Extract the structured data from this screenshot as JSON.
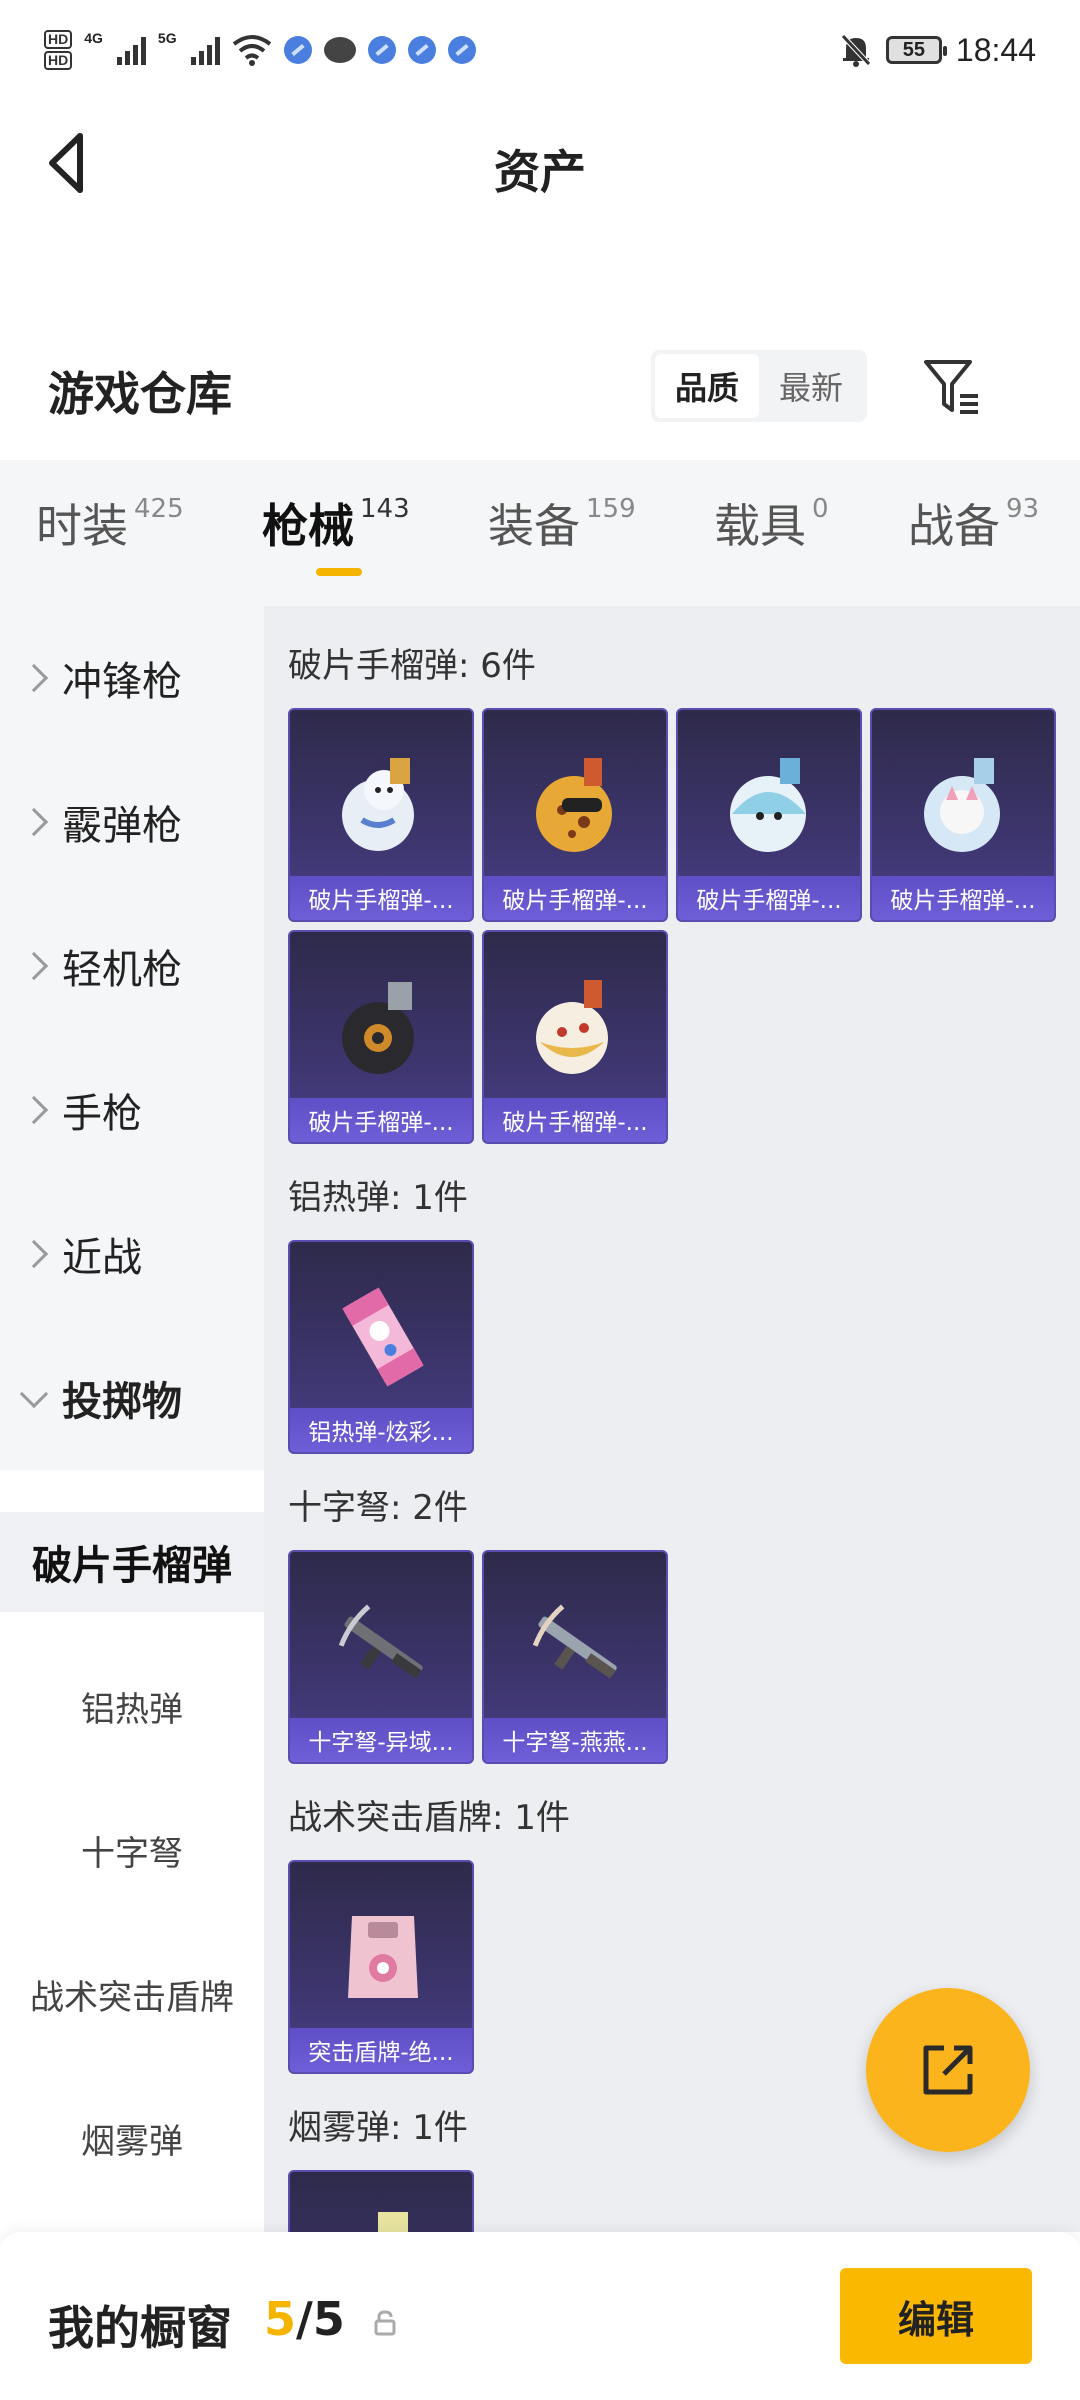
{
  "status_bar": {
    "time": "18:44",
    "battery": "55",
    "network_1": "4G",
    "network_2": "5G",
    "icons": [
      "hd-icon",
      "signal-icon",
      "signal-icon",
      "wifi-icon",
      "app-icon",
      "message-icon",
      "app-icon",
      "app-icon",
      "app-icon",
      "mute-bell-icon",
      "battery-icon"
    ]
  },
  "header": {
    "title": "资产"
  },
  "warehouse": {
    "title": "游戏仓库",
    "sort_options": [
      "品质",
      "最新"
    ],
    "sort_selected": "品质"
  },
  "tabs": [
    {
      "label": "时装",
      "count": "425"
    },
    {
      "label": "枪械",
      "count": "143",
      "active": true
    },
    {
      "label": "装备",
      "count": "159"
    },
    {
      "label": "载具",
      "count": "0"
    },
    {
      "label": "战备",
      "count": "93"
    }
  ],
  "sidebar": {
    "categories": [
      "冲锋枪",
      "霰弹枪",
      "轻机枪",
      "手枪",
      "近战",
      "投掷物"
    ],
    "open_category": "投掷物",
    "subitems": [
      "破片手榴弹",
      "铝热弹",
      "十字弩",
      "战术突击盾牌",
      "烟雾弹"
    ],
    "active_subitem": "破片手榴弹"
  },
  "groups": [
    {
      "title": "破片手榴弹: 6件",
      "items": [
        "破片手榴弹-...",
        "破片手榴弹-...",
        "破片手榴弹-...",
        "破片手榴弹-...",
        "破片手榴弹-...",
        "破片手榴弹-..."
      ]
    },
    {
      "title": "铝热弹: 1件",
      "items": [
        "铝热弹-炫彩..."
      ]
    },
    {
      "title": "十字弩: 2件",
      "items": [
        "十字弩-异域...",
        "十字弩-燕燕..."
      ]
    },
    {
      "title": "战术突击盾牌: 1件",
      "items": [
        "突击盾牌-绝..."
      ]
    },
    {
      "title": "烟雾弹: 1件",
      "items": [
        ""
      ]
    }
  ],
  "bottom_bar": {
    "label": "我的橱窗",
    "count_current": "5",
    "count_separator": "/",
    "count_total": "5",
    "edit_label": "编辑"
  },
  "colors": {
    "accent": "#fbb800",
    "card_bg": "#3e3670",
    "card_label": "#6e5fd8"
  }
}
